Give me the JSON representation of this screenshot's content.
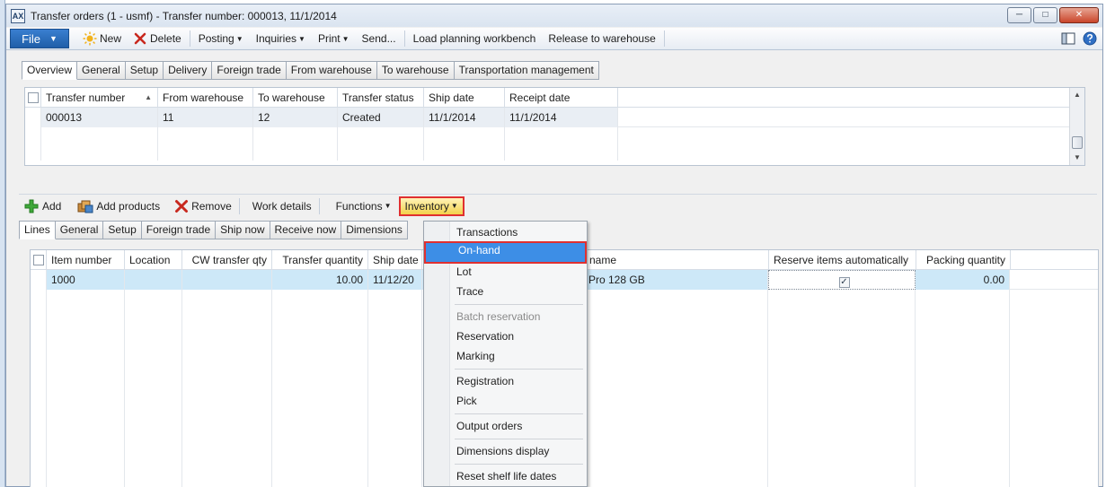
{
  "window": {
    "app_icon": "AX",
    "title": "Transfer orders (1 - usmf) - Transfer number: 000013, 11/1/2014",
    "minimize_glyph": "─",
    "maximize_glyph": "□",
    "close_glyph": "✕"
  },
  "actionpane": {
    "file_label": "File",
    "new_label": "New",
    "delete_label": "Delete",
    "posting_label": "Posting",
    "inquiries_label": "Inquiries",
    "print_label": "Print",
    "send_label": "Send...",
    "load_planning_label": "Load planning workbench",
    "release_label": "Release to warehouse"
  },
  "header": {
    "tabs": [
      "Overview",
      "General",
      "Setup",
      "Delivery",
      "Foreign trade",
      "From warehouse",
      "To warehouse",
      "Transportation management"
    ],
    "columns": [
      "Transfer number",
      "From warehouse",
      "To warehouse",
      "Transfer status",
      "Ship date",
      "Receipt date"
    ],
    "sort_glyph": "▲",
    "rows": [
      {
        "transfer_number": "000013",
        "from_warehouse": "11",
        "to_warehouse": "12",
        "transfer_status": "Created",
        "ship_date": "11/1/2014",
        "receipt_date": "11/1/2014"
      }
    ]
  },
  "lines_toolbar": {
    "add_label": "Add",
    "add_products_label": "Add products",
    "remove_label": "Remove",
    "work_details_label": "Work details",
    "functions_label": "Functions",
    "inventory_label": "Inventory"
  },
  "lines": {
    "tabs": [
      "Lines",
      "General",
      "Setup",
      "Foreign trade",
      "Ship now",
      "Receive now",
      "Dimensions"
    ],
    "columns": [
      "Item number",
      "Location",
      "CW transfer qty",
      "Transfer quantity",
      "Ship date",
      "name",
      "Reserve items automatically",
      "Packing quantity"
    ],
    "rows": [
      {
        "item_number": "1000",
        "location": "",
        "cw_transfer_qty": "",
        "transfer_quantity": "10.00",
        "ship_date": "11/12/20",
        "product_name": "Pro 128 GB",
        "reserve_auto_checked": true,
        "packing_quantity": "0.00"
      }
    ]
  },
  "inventory_menu": {
    "items": [
      {
        "label": "Transactions",
        "state": "normal"
      },
      {
        "label": "On-hand",
        "state": "active"
      },
      {
        "label": "Lot",
        "state": "normal"
      },
      {
        "label": "Trace",
        "state": "normal"
      },
      {
        "label": "Batch reservation",
        "state": "disabled"
      },
      {
        "label": "Reservation",
        "state": "normal"
      },
      {
        "label": "Marking",
        "state": "normal"
      },
      {
        "label": "Registration",
        "state": "normal"
      },
      {
        "label": "Pick",
        "state": "normal"
      },
      {
        "label": "Output orders",
        "state": "normal"
      },
      {
        "label": "Dimensions display",
        "state": "normal"
      },
      {
        "label": "Reset shelf life dates",
        "state": "normal"
      }
    ]
  },
  "colors": {
    "highlight_border": "#e03030",
    "menu_active_bg": "#3d8ee6",
    "selected_row_bg": "#cde8f8",
    "file_button_bg": "#1f5ea8"
  },
  "icons": {
    "new": "sun-star-icon",
    "delete": "red-x-icon",
    "add": "green-plus-icon",
    "add_products": "products-icon",
    "remove": "red-x-icon",
    "layout": "layout-icon",
    "help": "help-icon"
  }
}
